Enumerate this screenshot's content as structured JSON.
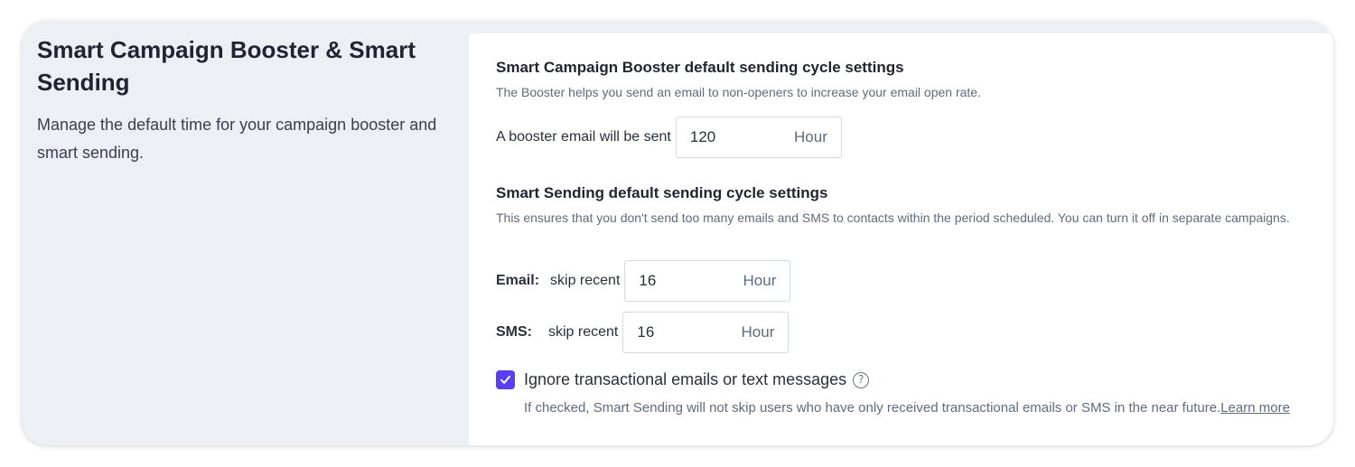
{
  "sidebar": {
    "title": "Smart Campaign Booster & Smart Sending",
    "description": "Manage the default time for your campaign booster and smart sending."
  },
  "booster": {
    "title": "Smart Campaign Booster default sending cycle settings",
    "description": "The Booster helps you send an email to non-openers to increase your email open rate.",
    "label": "A booster email will be sent",
    "value": "120",
    "unit": "Hour"
  },
  "smart_sending": {
    "title": "Smart Sending default sending cycle settings",
    "description": "This ensures that you don't send too many emails and SMS to contacts within the period scheduled. You can turn it off in separate campaigns.",
    "email": {
      "lead": "Email:",
      "label": "skip recent",
      "value": "16",
      "unit": "Hour"
    },
    "sms": {
      "lead": "SMS:",
      "label": "skip recent",
      "value": "16",
      "unit": "Hour"
    },
    "ignore_transactional": {
      "checked": true,
      "label": "Ignore transactional emails or text messages",
      "help_icon": "question-circle-icon",
      "note": "If checked, Smart Sending will not skip users who have only received transactional emails or SMS in the near future.",
      "link_text": "Learn more"
    }
  },
  "colors": {
    "accent": "#5b3df5",
    "background": "#eceff4",
    "panel": "#ffffff"
  }
}
